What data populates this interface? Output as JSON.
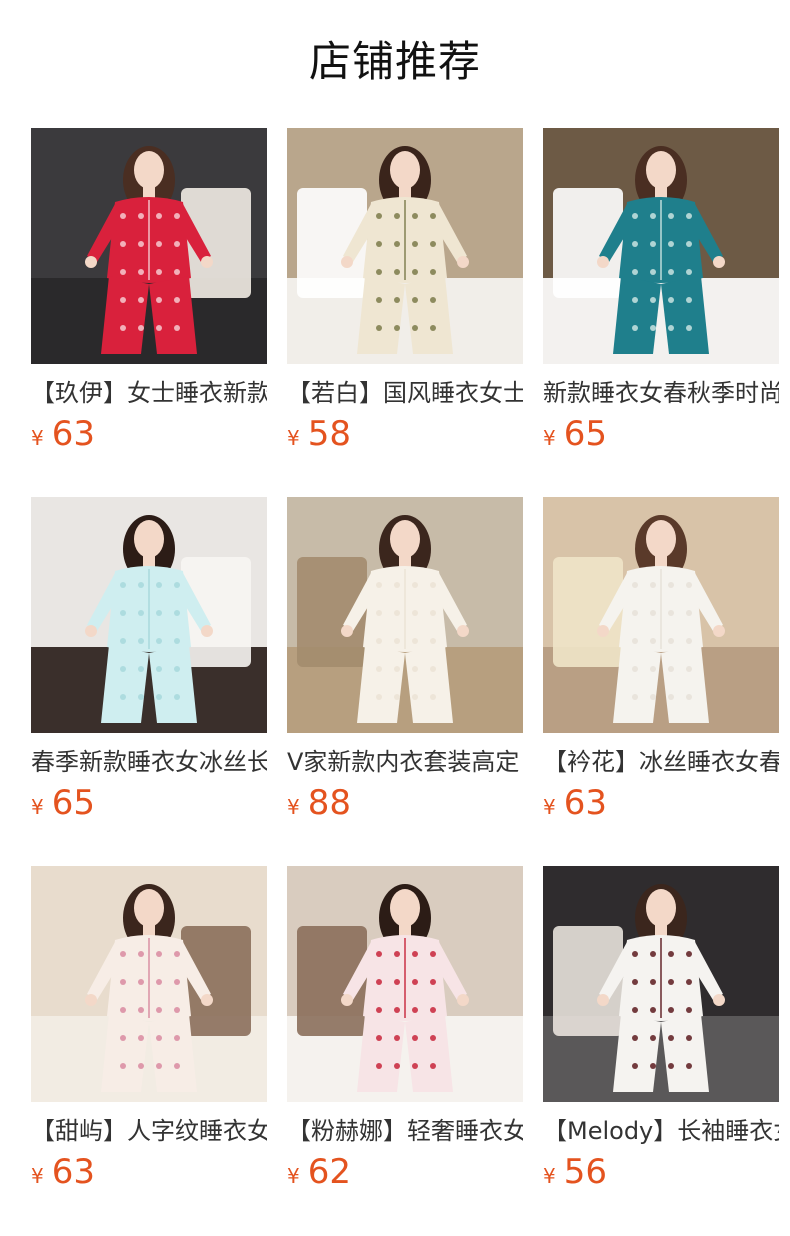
{
  "header": {
    "title": "店铺推荐"
  },
  "products": [
    {
      "title": "【玖伊】女士睡衣新款",
      "currency": "¥",
      "price": "63",
      "image": {
        "bg": "#3b3a3d",
        "floor": "#2a292b",
        "prop": "#f2ece4",
        "outfit": "#d9213c",
        "pattern": "#f6c9cf",
        "skin": "#f3d8c8",
        "hair": "#4a2e22"
      }
    },
    {
      "title": "【若白】国风睡衣女士",
      "currency": "¥",
      "price": "58",
      "image": {
        "bg": "#b9a68c",
        "floor": "#f1eee9",
        "prop": "#ffffff",
        "outfit": "#efe6d2",
        "pattern": "#7b7a4a",
        "skin": "#f3d8c8",
        "hair": "#3a241b"
      }
    },
    {
      "title": "新款睡衣女春秋季时尚",
      "currency": "¥",
      "price": "65",
      "image": {
        "bg": "#6d5a45",
        "floor": "#f3f1ef",
        "prop": "#ffffff",
        "outfit": "#1f7f8c",
        "pattern": "#c9e3e0",
        "skin": "#f3d8c8",
        "hair": "#4a2e22"
      }
    },
    {
      "title": "春季新款睡衣女冰丝长袖",
      "currency": "¥",
      "price": "65",
      "image": {
        "bg": "#e9e6e3",
        "floor": "#3a2f2b",
        "prop": "#f7f5f2",
        "outfit": "#cfeef0",
        "pattern": "#a7d8dc",
        "skin": "#f3d8c8",
        "hair": "#2c1c16"
      }
    },
    {
      "title": "V家新款内衣套装高定",
      "currency": "¥",
      "price": "88",
      "image": {
        "bg": "#c7bba8",
        "floor": "#b79f7f",
        "prop": "#a38c6e",
        "outfit": "#f6f1e8",
        "pattern": "#ebe3d5",
        "skin": "#f3d8c8",
        "hair": "#3b261d"
      }
    },
    {
      "title": "【衿花】冰丝睡衣女春秋",
      "currency": "¥",
      "price": "63",
      "image": {
        "bg": "#d8c3a8",
        "floor": "#b99f84",
        "prop": "#efe4c8",
        "outfit": "#f5f3ee",
        "pattern": "#e6e1d8",
        "skin": "#f3d8c8",
        "hair": "#5a3a2a"
      }
    },
    {
      "title": "【甜屿】人字纹睡衣女士",
      "currency": "¥",
      "price": "63",
      "image": {
        "bg": "#e8dccd",
        "floor": "#f2ece3",
        "prop": "#8b6f5b",
        "outfit": "#f7ede6",
        "pattern": "#d98aa0",
        "skin": "#f3d8c8",
        "hair": "#3b261d"
      }
    },
    {
      "title": "【粉赫娜】轻奢睡衣女士",
      "currency": "¥",
      "price": "62",
      "image": {
        "bg": "#d9ccbf",
        "floor": "#f5f2ee",
        "prop": "#8b6f5b",
        "outfit": "#f7e4e6",
        "pattern": "#c8243a",
        "skin": "#f3d8c8",
        "hair": "#2c1c16"
      }
    },
    {
      "title": "【Melody】长袖睡衣女士",
      "currency": "¥",
      "price": "56",
      "image": {
        "bg": "#2f2c2e",
        "floor": "#5a5859",
        "prop": "#e8e2dc",
        "outfit": "#f5f3f0",
        "pattern": "#5c1a1f",
        "skin": "#f3d8c8",
        "hair": "#3b261d"
      }
    }
  ]
}
